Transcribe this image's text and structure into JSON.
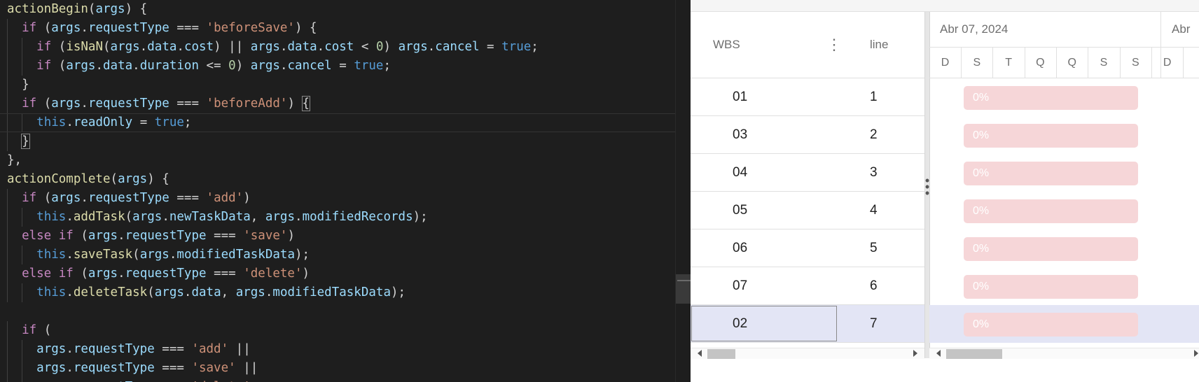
{
  "editor": {
    "lines": [
      {
        "indent": 0,
        "tokens": [
          [
            "fn",
            "actionBegin"
          ],
          [
            "p",
            "("
          ],
          [
            "var",
            "args"
          ],
          [
            "p",
            ") {"
          ]
        ]
      },
      {
        "indent": 1,
        "tokens": [
          [
            "kw",
            "if"
          ],
          [
            "p",
            " ("
          ],
          [
            "var",
            "args"
          ],
          [
            "p",
            "."
          ],
          [
            "var",
            "requestType"
          ],
          [
            "p",
            " === "
          ],
          [
            "str",
            "'beforeSave'"
          ],
          [
            "p",
            ") {"
          ]
        ]
      },
      {
        "indent": 2,
        "tokens": [
          [
            "kw",
            "if"
          ],
          [
            "p",
            " ("
          ],
          [
            "fn",
            "isNaN"
          ],
          [
            "p",
            "("
          ],
          [
            "var",
            "args"
          ],
          [
            "p",
            "."
          ],
          [
            "var",
            "data"
          ],
          [
            "p",
            "."
          ],
          [
            "var",
            "cost"
          ],
          [
            "p",
            ") || "
          ],
          [
            "var",
            "args"
          ],
          [
            "p",
            "."
          ],
          [
            "var",
            "data"
          ],
          [
            "p",
            "."
          ],
          [
            "var",
            "cost"
          ],
          [
            "p",
            " < "
          ],
          [
            "num",
            "0"
          ],
          [
            "p",
            ") "
          ],
          [
            "var",
            "args"
          ],
          [
            "p",
            "."
          ],
          [
            "var",
            "cancel"
          ],
          [
            "p",
            " = "
          ],
          [
            "bool",
            "true"
          ],
          [
            "p",
            ";"
          ]
        ]
      },
      {
        "indent": 2,
        "tokens": [
          [
            "kw",
            "if"
          ],
          [
            "p",
            " ("
          ],
          [
            "var",
            "args"
          ],
          [
            "p",
            "."
          ],
          [
            "var",
            "data"
          ],
          [
            "p",
            "."
          ],
          [
            "var",
            "duration"
          ],
          [
            "p",
            " <= "
          ],
          [
            "num",
            "0"
          ],
          [
            "p",
            ") "
          ],
          [
            "var",
            "args"
          ],
          [
            "p",
            "."
          ],
          [
            "var",
            "cancel"
          ],
          [
            "p",
            " = "
          ],
          [
            "bool",
            "true"
          ],
          [
            "p",
            ";"
          ]
        ]
      },
      {
        "indent": 1,
        "tokens": [
          [
            "p",
            "}"
          ]
        ]
      },
      {
        "indent": 1,
        "tokens": [
          [
            "kw",
            "if"
          ],
          [
            "p",
            " ("
          ],
          [
            "var",
            "args"
          ],
          [
            "p",
            "."
          ],
          [
            "var",
            "requestType"
          ],
          [
            "p",
            " === "
          ],
          [
            "str",
            "'beforeAdd'"
          ],
          [
            "p",
            ") "
          ],
          [
            "brace",
            "{"
          ]
        ]
      },
      {
        "indent": 2,
        "active": true,
        "tokens": [
          [
            "this",
            "this"
          ],
          [
            "p",
            "."
          ],
          [
            "var",
            "readOnly"
          ],
          [
            "p",
            " = "
          ],
          [
            "bool",
            "true"
          ],
          [
            "p",
            ";"
          ]
        ]
      },
      {
        "indent": 1,
        "tokens": [
          [
            "brace",
            "}"
          ]
        ]
      },
      {
        "indent": 0,
        "tokens": [
          [
            "p",
            "},"
          ]
        ]
      },
      {
        "indent": 0,
        "tokens": [
          [
            "fn",
            "actionComplete"
          ],
          [
            "p",
            "("
          ],
          [
            "var",
            "args"
          ],
          [
            "p",
            ") {"
          ]
        ]
      },
      {
        "indent": 1,
        "tokens": [
          [
            "kw",
            "if"
          ],
          [
            "p",
            " ("
          ],
          [
            "var",
            "args"
          ],
          [
            "p",
            "."
          ],
          [
            "var",
            "requestType"
          ],
          [
            "p",
            " === "
          ],
          [
            "str",
            "'add'"
          ],
          [
            "p",
            ")"
          ]
        ]
      },
      {
        "indent": 2,
        "tokens": [
          [
            "this",
            "this"
          ],
          [
            "p",
            "."
          ],
          [
            "fn",
            "addTask"
          ],
          [
            "p",
            "("
          ],
          [
            "var",
            "args"
          ],
          [
            "p",
            "."
          ],
          [
            "var",
            "newTaskData"
          ],
          [
            "p",
            ", "
          ],
          [
            "var",
            "args"
          ],
          [
            "p",
            "."
          ],
          [
            "var",
            "modifiedRecords"
          ],
          [
            "p",
            ");"
          ]
        ]
      },
      {
        "indent": 1,
        "tokens": [
          [
            "kw",
            "else if"
          ],
          [
            "p",
            " ("
          ],
          [
            "var",
            "args"
          ],
          [
            "p",
            "."
          ],
          [
            "var",
            "requestType"
          ],
          [
            "p",
            " === "
          ],
          [
            "str",
            "'save'"
          ],
          [
            "p",
            ")"
          ]
        ]
      },
      {
        "indent": 2,
        "tokens": [
          [
            "this",
            "this"
          ],
          [
            "p",
            "."
          ],
          [
            "fn",
            "saveTask"
          ],
          [
            "p",
            "("
          ],
          [
            "var",
            "args"
          ],
          [
            "p",
            "."
          ],
          [
            "var",
            "modifiedTaskData"
          ],
          [
            "p",
            ");"
          ]
        ]
      },
      {
        "indent": 1,
        "tokens": [
          [
            "kw",
            "else if"
          ],
          [
            "p",
            " ("
          ],
          [
            "var",
            "args"
          ],
          [
            "p",
            "."
          ],
          [
            "var",
            "requestType"
          ],
          [
            "p",
            " === "
          ],
          [
            "str",
            "'delete'"
          ],
          [
            "p",
            ")"
          ]
        ]
      },
      {
        "indent": 2,
        "tokens": [
          [
            "this",
            "this"
          ],
          [
            "p",
            "."
          ],
          [
            "fn",
            "deleteTask"
          ],
          [
            "p",
            "("
          ],
          [
            "var",
            "args"
          ],
          [
            "p",
            "."
          ],
          [
            "var",
            "data"
          ],
          [
            "p",
            ", "
          ],
          [
            "var",
            "args"
          ],
          [
            "p",
            "."
          ],
          [
            "var",
            "modifiedTaskData"
          ],
          [
            "p",
            ");"
          ]
        ]
      },
      {
        "indent": 0,
        "tokens": []
      },
      {
        "indent": 1,
        "tokens": [
          [
            "kw",
            "if"
          ],
          [
            "p",
            " ("
          ]
        ]
      },
      {
        "indent": 2,
        "tokens": [
          [
            "var",
            "args"
          ],
          [
            "p",
            "."
          ],
          [
            "var",
            "requestType"
          ],
          [
            "p",
            " === "
          ],
          [
            "str",
            "'add'"
          ],
          [
            "p",
            " ||"
          ]
        ]
      },
      {
        "indent": 2,
        "tokens": [
          [
            "var",
            "args"
          ],
          [
            "p",
            "."
          ],
          [
            "var",
            "requestType"
          ],
          [
            "p",
            " === "
          ],
          [
            "str",
            "'save'"
          ],
          [
            "p",
            " ||"
          ]
        ]
      },
      {
        "indent": 2,
        "tokens": [
          [
            "var",
            "args"
          ],
          [
            "p",
            "."
          ],
          [
            "var",
            "requestType"
          ],
          [
            "p",
            " === "
          ],
          [
            "str",
            "'delete'"
          ]
        ]
      }
    ]
  },
  "gantt": {
    "grid": {
      "header_wbs": "WBS",
      "header_line": "line",
      "menu_icon": "vertical-ellipsis-icon",
      "rows": [
        {
          "wbs": "01",
          "line": "1"
        },
        {
          "wbs": "03",
          "line": "2"
        },
        {
          "wbs": "04",
          "line": "3"
        },
        {
          "wbs": "05",
          "line": "4"
        },
        {
          "wbs": "06",
          "line": "5"
        },
        {
          "wbs": "07",
          "line": "6"
        },
        {
          "wbs": "02",
          "line": "7",
          "selected": true
        }
      ]
    },
    "timeline": {
      "week1_label": "Abr 07, 2024",
      "week2_label": "Abr",
      "days": [
        "D",
        "S",
        "T",
        "Q",
        "Q",
        "S",
        "S",
        "D"
      ]
    },
    "bars": [
      {
        "progress_label": "0%"
      },
      {
        "progress_label": "0%"
      },
      {
        "progress_label": "0%"
      },
      {
        "progress_label": "0%"
      },
      {
        "progress_label": "0%"
      },
      {
        "progress_label": "0%"
      },
      {
        "progress_label": "0%"
      }
    ],
    "colors": {
      "bar_fill": "#f6d6d8",
      "selected_row": "#e3e5f5",
      "editor_bg": "#1e1e1e"
    }
  }
}
